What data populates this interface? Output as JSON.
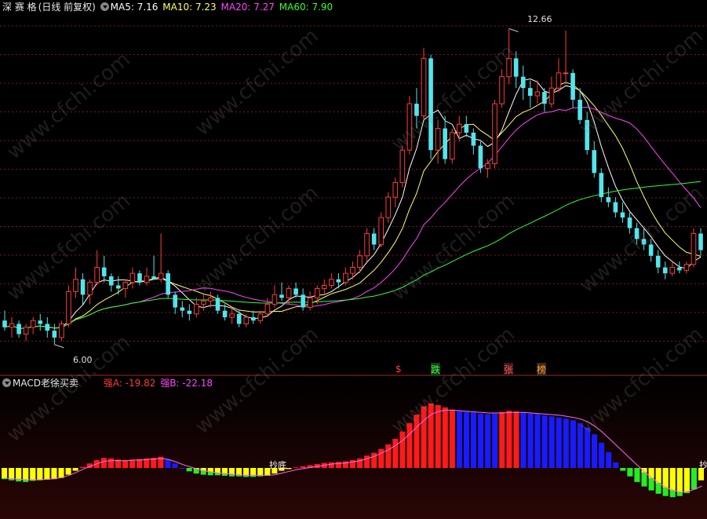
{
  "header": {
    "stock": "深 赛 格",
    "period": "(日线 前复权)",
    "ma5": "MA5: 7.16",
    "ma10": "MA10: 7.23",
    "ma20": "MA20: 7.27",
    "ma60": "MA60: 7.90"
  },
  "sub_header": {
    "indicator": "MACD老徐买卖",
    "strong_a": "强A: -19.82",
    "strong_b": "强B: -22.18"
  },
  "annotations": {
    "high_price": "12.66",
    "low_price": "6.00",
    "mark_s": "$",
    "mark_die": "跌",
    "mark_zhang": "张",
    "mark_bang": "榜",
    "text_low1": "抄底",
    "text_low2": "抄"
  },
  "watermark": "www.cfchi.com",
  "colors": {
    "up": "#ff3b3b",
    "down": "#54e4ec",
    "ma5": "#ffffff",
    "ma10": "#ffff66",
    "ma20": "#ff44ff",
    "ma60": "#33ff33",
    "grid": "#7a1a1a",
    "bar_red": "#ff1a1a",
    "bar_blue": "#1a1aff",
    "bar_yellow": "#ffff00",
    "bar_green": "#22ee22"
  },
  "chart_data": [
    {
      "type": "candlestick",
      "title": "深 赛 格",
      "ylim": [
        5.6,
        13.1
      ],
      "y_log": true,
      "price_high": 12.66,
      "price_low": 6.0,
      "ma_last": {
        "MA5": 7.16,
        "MA10": 7.23,
        "MA20": 7.27,
        "MA60": 7.9
      },
      "candles": [
        [
          6.35,
          6.5,
          6.2,
          6.25
        ],
        [
          6.25,
          6.4,
          6.1,
          6.3
        ],
        [
          6.3,
          6.35,
          6.1,
          6.15
        ],
        [
          6.15,
          6.3,
          6.05,
          6.25
        ],
        [
          6.25,
          6.4,
          6.15,
          6.35
        ],
        [
          6.35,
          6.45,
          6.2,
          6.3
        ],
        [
          6.3,
          6.4,
          6.1,
          6.2
        ],
        [
          6.2,
          6.3,
          6.0,
          6.1
        ],
        [
          6.1,
          6.35,
          6.05,
          6.3
        ],
        [
          6.3,
          6.9,
          6.25,
          6.8
        ],
        [
          6.8,
          7.2,
          6.7,
          7.0
        ],
        [
          7.0,
          7.1,
          6.6,
          6.75
        ],
        [
          6.75,
          7.0,
          6.6,
          6.95
        ],
        [
          6.95,
          7.5,
          6.9,
          7.2
        ],
        [
          7.2,
          7.4,
          6.95,
          7.05
        ],
        [
          7.05,
          7.1,
          6.8,
          6.9
        ],
        [
          6.9,
          7.05,
          6.75,
          6.85
        ],
        [
          6.85,
          7.0,
          6.7,
          6.95
        ],
        [
          6.95,
          7.2,
          6.85,
          7.1
        ],
        [
          7.1,
          7.15,
          6.9,
          6.95
        ],
        [
          6.95,
          7.2,
          6.9,
          7.05
        ],
        [
          7.05,
          7.4,
          7.0,
          7.0
        ],
        [
          7.0,
          7.8,
          6.95,
          7.1
        ],
        [
          7.1,
          7.15,
          6.7,
          6.75
        ],
        [
          6.75,
          6.8,
          6.45,
          6.55
        ],
        [
          6.55,
          6.65,
          6.4,
          6.5
        ],
        [
          6.5,
          6.6,
          6.35,
          6.45
        ],
        [
          6.45,
          6.7,
          6.4,
          6.6
        ],
        [
          6.6,
          6.75,
          6.5,
          6.65
        ],
        [
          6.65,
          6.8,
          6.55,
          6.7
        ],
        [
          6.7,
          6.75,
          6.45,
          6.5
        ],
        [
          6.5,
          6.6,
          6.35,
          6.4
        ],
        [
          6.4,
          6.55,
          6.3,
          6.45
        ],
        [
          6.45,
          6.5,
          6.25,
          6.3
        ],
        [
          6.3,
          6.45,
          6.25,
          6.4
        ],
        [
          6.4,
          6.5,
          6.3,
          6.35
        ],
        [
          6.35,
          6.5,
          6.3,
          6.45
        ],
        [
          6.45,
          6.7,
          6.4,
          6.6
        ],
        [
          6.6,
          6.9,
          6.55,
          6.75
        ],
        [
          6.75,
          6.95,
          6.65,
          6.7
        ],
        [
          6.7,
          6.9,
          6.6,
          6.85
        ],
        [
          6.85,
          6.95,
          6.7,
          6.75
        ],
        [
          6.75,
          6.85,
          6.5,
          6.55
        ],
        [
          6.55,
          6.8,
          6.5,
          6.7
        ],
        [
          6.7,
          6.9,
          6.6,
          6.85
        ],
        [
          6.85,
          7.0,
          6.75,
          6.9
        ],
        [
          6.9,
          7.1,
          6.85,
          7.0
        ],
        [
          7.0,
          7.1,
          6.85,
          6.95
        ],
        [
          6.95,
          7.2,
          6.9,
          7.1
        ],
        [
          7.1,
          7.3,
          7.0,
          7.2
        ],
        [
          7.2,
          7.5,
          7.1,
          7.4
        ],
        [
          7.4,
          7.9,
          7.3,
          7.8
        ],
        [
          7.8,
          7.9,
          7.5,
          7.6
        ],
        [
          7.6,
          8.2,
          7.55,
          8.1
        ],
        [
          8.1,
          8.6,
          8.0,
          8.5
        ],
        [
          8.5,
          8.9,
          8.3,
          8.8
        ],
        [
          8.8,
          9.6,
          8.7,
          9.5
        ],
        [
          9.5,
          10.8,
          9.4,
          10.6
        ],
        [
          10.6,
          11.0,
          10.0,
          10.3
        ],
        [
          10.3,
          12.1,
          10.2,
          11.8
        ],
        [
          11.8,
          11.9,
          9.3,
          9.5
        ],
        [
          9.5,
          10.2,
          9.2,
          10.0
        ],
        [
          10.0,
          10.3,
          9.2,
          9.3
        ],
        [
          9.3,
          10.0,
          9.2,
          9.9
        ],
        [
          9.9,
          10.3,
          9.7,
          10.1
        ],
        [
          10.1,
          10.3,
          9.8,
          9.9
        ],
        [
          9.9,
          10.0,
          9.4,
          9.6
        ],
        [
          9.6,
          9.7,
          9.0,
          9.1
        ],
        [
          9.1,
          9.3,
          8.9,
          9.2
        ],
        [
          9.2,
          10.7,
          9.1,
          10.6
        ],
        [
          10.6,
          11.5,
          10.5,
          11.3
        ],
        [
          11.3,
          12.66,
          11.1,
          11.8
        ],
        [
          11.8,
          12.0,
          11.0,
          11.3
        ],
        [
          11.3,
          11.6,
          10.7,
          11.0
        ],
        [
          11.0,
          11.2,
          10.5,
          10.8
        ],
        [
          10.8,
          11.2,
          10.6,
          10.9
        ],
        [
          10.9,
          11.0,
          10.4,
          10.6
        ],
        [
          10.6,
          11.3,
          10.5,
          11.0
        ],
        [
          11.0,
          11.8,
          10.9,
          11.4
        ],
        [
          11.4,
          12.6,
          11.1,
          11.4
        ],
        [
          11.4,
          11.5,
          10.5,
          10.7
        ],
        [
          10.7,
          11.0,
          10.1,
          10.2
        ],
        [
          10.2,
          10.4,
          9.4,
          9.5
        ],
        [
          9.5,
          9.7,
          8.9,
          9.0
        ],
        [
          9.0,
          9.1,
          8.4,
          8.5
        ],
        [
          8.5,
          8.7,
          8.3,
          8.4
        ],
        [
          8.4,
          8.5,
          8.1,
          8.2
        ],
        [
          8.2,
          8.4,
          8.0,
          8.1
        ],
        [
          8.1,
          8.2,
          7.8,
          7.9
        ],
        [
          7.9,
          8.0,
          7.6,
          7.7
        ],
        [
          7.7,
          7.9,
          7.5,
          7.6
        ],
        [
          7.6,
          7.7,
          7.3,
          7.4
        ],
        [
          7.4,
          7.5,
          7.1,
          7.2
        ],
        [
          7.2,
          7.3,
          7.0,
          7.1
        ],
        [
          7.1,
          7.3,
          7.05,
          7.2
        ],
        [
          7.2,
          7.3,
          7.1,
          7.15
        ],
        [
          7.15,
          7.3,
          7.1,
          7.25
        ],
        [
          7.25,
          7.9,
          7.2,
          7.8
        ],
        [
          7.8,
          7.9,
          7.4,
          7.5
        ]
      ]
    },
    {
      "type": "bar",
      "title": "MACD老徐买卖",
      "series_names": [
        "强A",
        "强B"
      ],
      "last_values": {
        "强A": -19.82,
        "强B": -22.18
      },
      "ylim": [
        -60,
        140
      ],
      "values": [
        -20,
        -22,
        -24,
        -25,
        -23,
        -22,
        -21,
        -20,
        -18,
        -12,
        -5,
        2,
        8,
        14,
        18,
        17,
        15,
        14,
        15,
        16,
        17,
        18,
        20,
        15,
        8,
        0,
        -6,
        -10,
        -12,
        -13,
        -13,
        -14,
        -15,
        -15,
        -16,
        -16,
        -15,
        -14,
        -10,
        -5,
        -2,
        1,
        3,
        5,
        7,
        9,
        10,
        11,
        12,
        14,
        17,
        22,
        27,
        34,
        42,
        52,
        65,
        80,
        95,
        110,
        115,
        112,
        108,
        104,
        102,
        100,
        99,
        97,
        96,
        97,
        100,
        102,
        101,
        99,
        97,
        96,
        94,
        92,
        90,
        88,
        85,
        80,
        72,
        60,
        45,
        28,
        10,
        -5,
        -15,
        -25,
        -33,
        -40,
        -46,
        -50,
        -52,
        -50,
        -45,
        -38,
        -22
      ],
      "values_b": [
        -18,
        -19,
        -20,
        -21,
        -21,
        -21,
        -20,
        -19,
        -17,
        -13,
        -8,
        -2,
        3,
        8,
        12,
        13,
        13,
        13,
        14,
        14,
        15,
        16,
        17,
        15,
        11,
        6,
        2,
        -2,
        -5,
        -7,
        -9,
        -10,
        -11,
        -12,
        -13,
        -13,
        -13,
        -13,
        -12,
        -9,
        -6,
        -3,
        -1,
        1,
        3,
        5,
        7,
        8,
        9,
        11,
        13,
        17,
        21,
        27,
        33,
        41,
        50,
        62,
        74,
        86,
        96,
        101,
        103,
        103,
        102,
        101,
        100,
        99,
        98,
        98,
        98,
        99,
        99,
        99,
        98,
        97,
        96,
        95,
        94,
        92,
        90,
        87,
        82,
        74,
        64,
        52,
        40,
        28,
        16,
        4,
        -8,
        -18,
        -27,
        -35,
        -40,
        -43,
        -42,
        -38,
        -32
      ]
    }
  ]
}
